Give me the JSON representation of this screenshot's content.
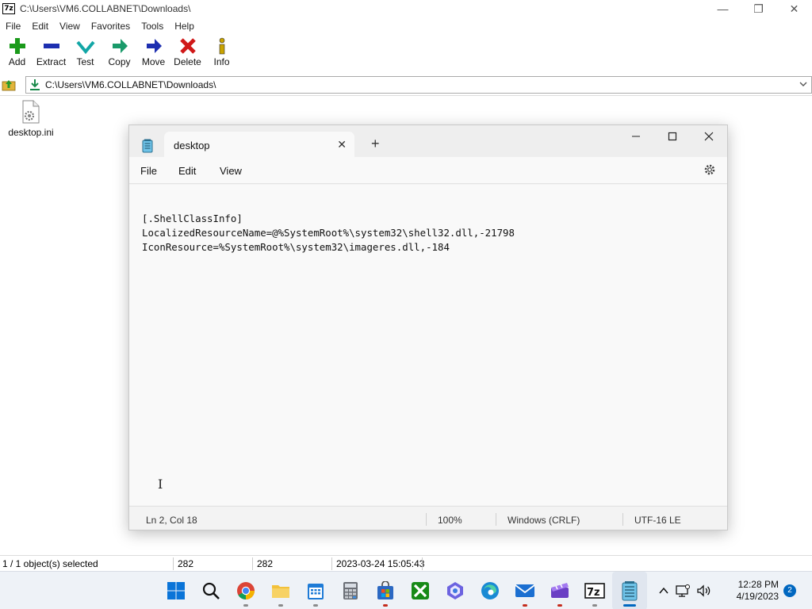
{
  "zip": {
    "title": "C:\\Users\\VM6.COLLABNET\\Downloads\\",
    "logo": "7z",
    "menu": [
      "File",
      "Edit",
      "View",
      "Favorites",
      "Tools",
      "Help"
    ],
    "toolbar": [
      {
        "label": "Add",
        "icon": "plus-icon"
      },
      {
        "label": "Extract",
        "icon": "minus-icon"
      },
      {
        "label": "Test",
        "icon": "check-icon"
      },
      {
        "label": "Copy",
        "icon": "right-arrow-icon"
      },
      {
        "label": "Move",
        "icon": "move-arrow-icon"
      },
      {
        "label": "Delete",
        "icon": "delete-x-icon"
      },
      {
        "label": "Info",
        "icon": "info-icon"
      }
    ],
    "address": "C:\\Users\\VM6.COLLABNET\\Downloads\\",
    "files": [
      {
        "name": "desktop.ini",
        "icon": "settings-file-icon"
      }
    ],
    "status": {
      "selection": "1 / 1 object(s) selected",
      "size": "282",
      "packed": "282",
      "modified": "2023-03-24 15:05:43"
    }
  },
  "notepad": {
    "tab_title": "desktop",
    "menu": {
      "file": "File",
      "edit": "Edit",
      "view": "View"
    },
    "content": "[.ShellClassInfo]\nLocalizedResourceName=@%SystemRoot%\\system32\\shell32.dll,-21798\nIconResource=%SystemRoot%\\system32\\imageres.dll,-184",
    "status": {
      "position": "Ln 2, Col 18",
      "zoom": "100%",
      "line_ending": "Windows (CRLF)",
      "encoding": "UTF-16 LE"
    }
  },
  "taskbar": {
    "apps": [
      "windows-start-icon",
      "search-icon",
      "chrome-icon",
      "file-explorer-icon",
      "calendar-icon",
      "calculator-icon",
      "store-icon",
      "xbox-icon",
      "copilot-icon",
      "edge-icon",
      "mail-icon",
      "clipchamp-icon",
      "7zip-icon",
      "notepad-icon"
    ],
    "time": "12:28 PM",
    "date": "4/19/2023",
    "notification_count": "2",
    "accent": "#0067c0"
  }
}
